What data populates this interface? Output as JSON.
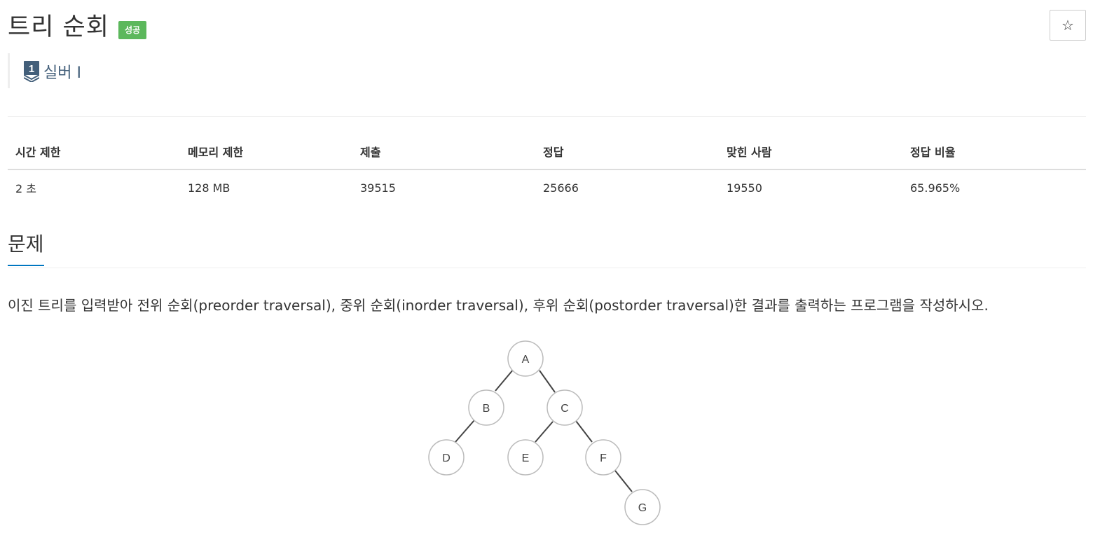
{
  "problem": {
    "title": "트리 순회",
    "status": "성공",
    "star_label": "☆",
    "tier_number": "1",
    "tier_label": "실버 I"
  },
  "info_table": {
    "headers": [
      "시간 제한",
      "메모리 제한",
      "제출",
      "정답",
      "맞힌 사람",
      "정답 비율"
    ],
    "values": [
      "2 초",
      "128 MB",
      "39515",
      "25666",
      "19550",
      "65.965%"
    ]
  },
  "section": {
    "title": "문제",
    "description": "이진 트리를 입력받아 전위 순회(preorder traversal), 중위 순회(inorder traversal), 후위 순회(postorder traversal)한 결과를 출력하는 프로그램을 작성하시오."
  },
  "tree": {
    "nodes": [
      "A",
      "B",
      "C",
      "D",
      "E",
      "F",
      "G"
    ]
  },
  "colors": {
    "badge": "#5cb85c",
    "tier": "#435f7a",
    "section_underline": "#0076c0"
  }
}
